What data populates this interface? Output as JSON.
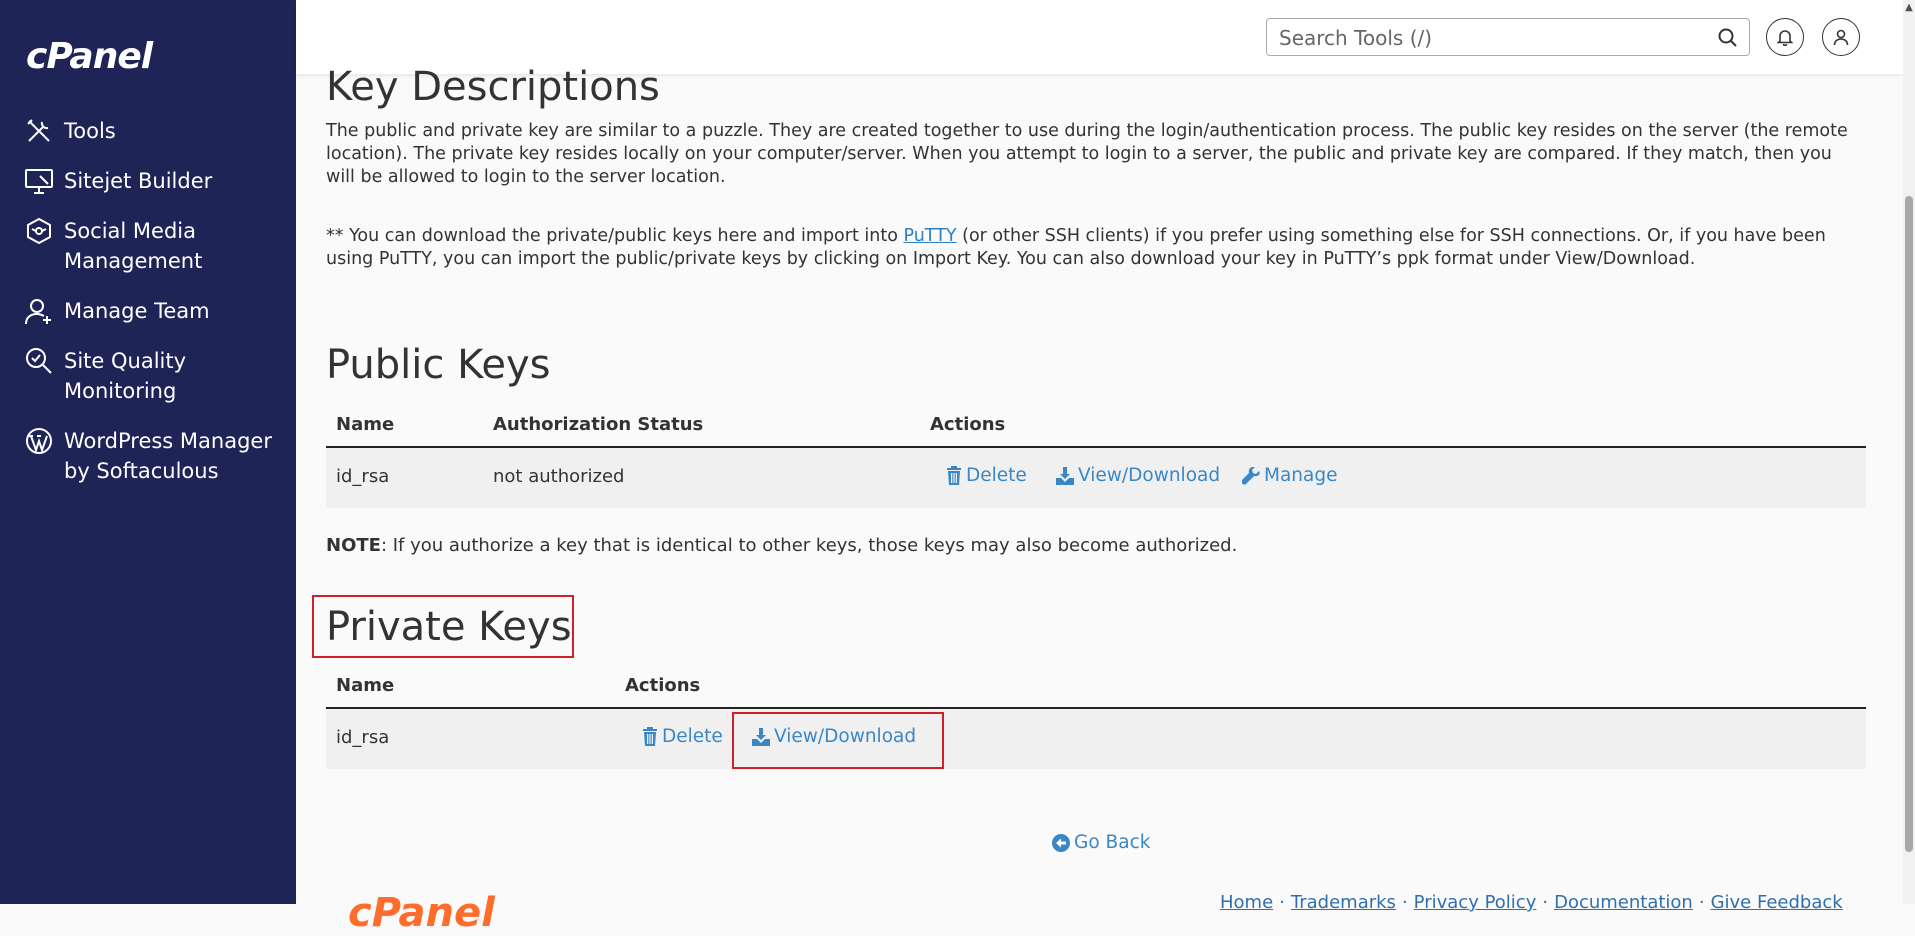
{
  "sidebar": {
    "logo": "cPanel",
    "items": [
      {
        "label": "Tools"
      },
      {
        "label": "Sitejet Builder"
      },
      {
        "label": "Social Media Management"
      },
      {
        "label": "Manage Team"
      },
      {
        "label": "Site Quality Monitoring"
      },
      {
        "label": "WordPress Manager by Softaculous"
      }
    ]
  },
  "header": {
    "search_placeholder": "Search Tools (/)"
  },
  "key_descriptions": {
    "title": "Key Descriptions",
    "paragraph1": "The public and private key are similar to a puzzle. They are created together to use during the login/authentication process. The public key resides on the server (the remote location). The private key resides locally on your computer/server. When you attempt to login to a server, the public and private key are compared. If they match, then you will be allowed to login to the server location.",
    "paragraph2_prefix": "** You can download the private/public keys here and import into ",
    "paragraph2_link": "PuTTY",
    "paragraph2_suffix": " (or other SSH clients) if you prefer using something else for SSH connections. Or, if you have been using PuTTY, you can import the public/private keys by clicking on Import Key. You can also download your key in PuTTY’s ppk format under View/Download."
  },
  "public_keys": {
    "title": "Public Keys",
    "columns": [
      "Name",
      "Authorization Status",
      "Actions"
    ],
    "rows": [
      {
        "name": "id_rsa",
        "status": "not authorized",
        "delete": "Delete",
        "view": "View/Download",
        "manage": "Manage"
      }
    ]
  },
  "note": {
    "label": "NOTE",
    "text": ": If you authorize a key that is identical to other keys, those keys may also become authorized."
  },
  "private_keys": {
    "title": "Private Keys",
    "columns": [
      "Name",
      "Actions"
    ],
    "rows": [
      {
        "name": "id_rsa",
        "delete": "Delete",
        "view": "View/Download"
      }
    ]
  },
  "go_back": "Go Back",
  "footer": {
    "logo": "cPanel",
    "links": [
      "Home",
      "Trademarks",
      "Privacy Policy",
      "Documentation",
      "Give Feedback"
    ]
  },
  "colors": {
    "sidebar_bg": "#1f2456",
    "link": "#3b87c6",
    "highlight": "#d0202a"
  }
}
